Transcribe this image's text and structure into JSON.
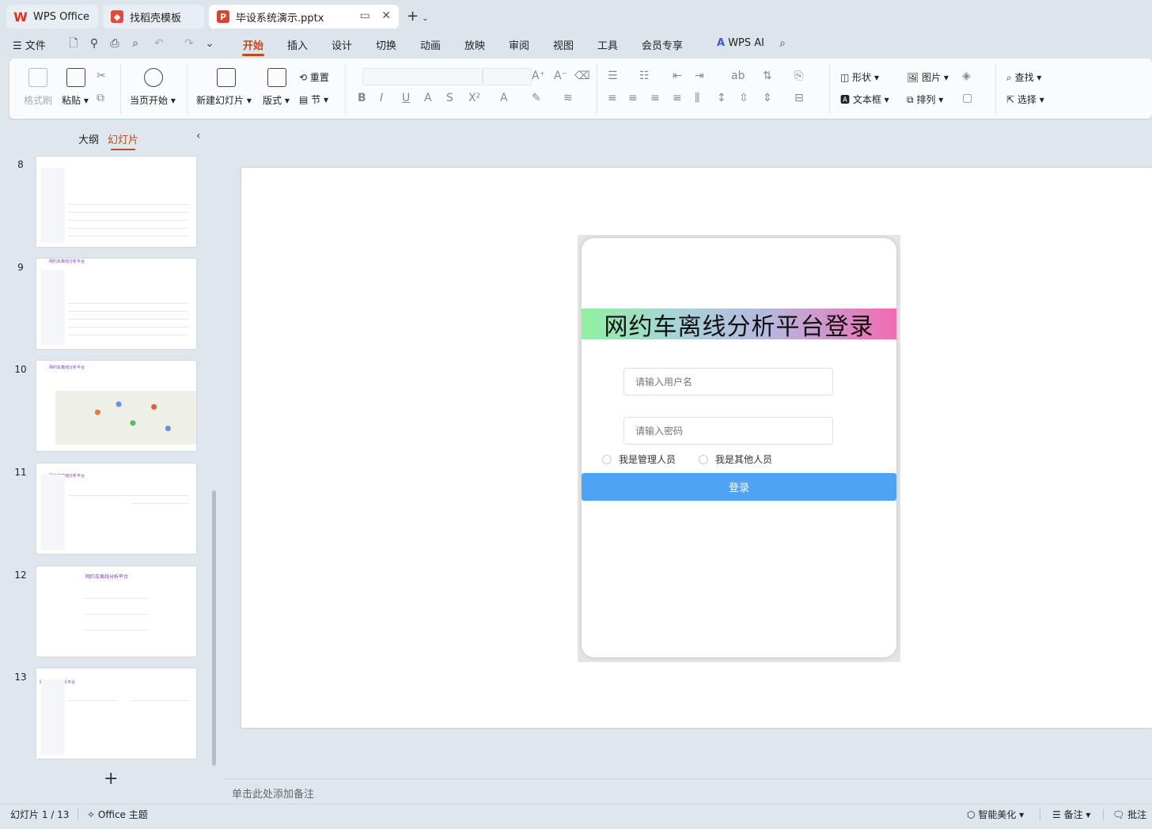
{
  "tabs": {
    "wps": "WPS Office",
    "template": "找稻壳模板",
    "document": "毕设系统演示.pptx"
  },
  "menu": {
    "file": "文件",
    "items": [
      "开始",
      "插入",
      "设计",
      "切换",
      "动画",
      "放映",
      "审阅",
      "视图",
      "工具",
      "会员专享"
    ],
    "ai": "WPS AI"
  },
  "ribbon": {
    "format_painter": "格式刷",
    "paste": "粘贴",
    "from_start": "当页开始",
    "new_slide": "新建幻灯片",
    "layout": "版式",
    "reset": "重置",
    "section": "节",
    "shape": "形状",
    "picture": "图片",
    "textbox": "文本框",
    "arrange": "排列",
    "find": "查找",
    "select": "选择"
  },
  "panel": {
    "outline_tab": "大纲",
    "slides_tab": "幻灯片",
    "slide_numbers": [
      "8",
      "9",
      "10",
      "11",
      "12",
      "13"
    ],
    "thumb_title": "网约车离线分析平台"
  },
  "slide": {
    "title": "网约车离线分析平台登录",
    "username_placeholder": "请输入用户名",
    "password_placeholder": "请输入密码",
    "radio_admin": "我是管理人员",
    "radio_other": "我是其他人员",
    "login_button": "登录"
  },
  "notes_placeholder": "单击此处添加备注",
  "status": {
    "slide_count": "幻灯片 1 / 13",
    "theme": "Office 主题",
    "beautify": "智能美化",
    "notes": "备注",
    "comment": "批注"
  },
  "colors": {
    "accent": "#c4491c",
    "login_button": "#4ea3f5"
  }
}
